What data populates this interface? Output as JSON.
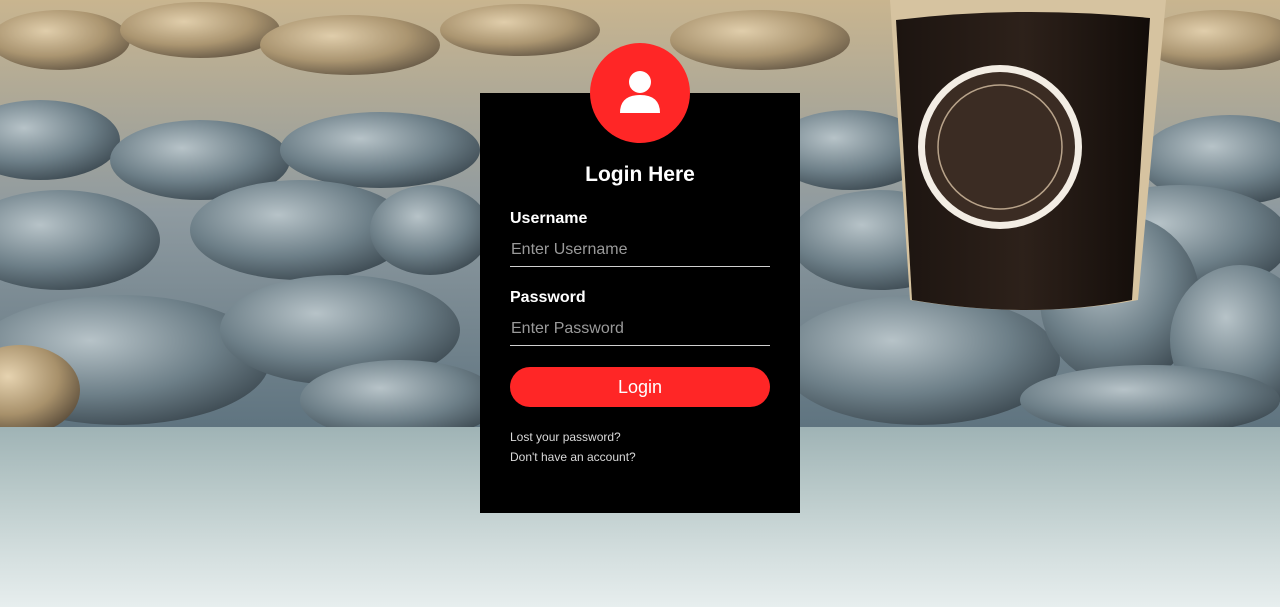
{
  "form": {
    "title": "Login Here",
    "username_label": "Username",
    "username_placeholder": "Enter Username",
    "password_label": "Password",
    "password_placeholder": "Enter Password",
    "login_button": "Login",
    "lost_password_link": "Lost your password?",
    "signup_link": "Don't have an account?"
  },
  "colors": {
    "accent": "#ff2626",
    "box_background": "#000000",
    "text": "#ffffff"
  },
  "icons": {
    "avatar": "user-icon"
  }
}
